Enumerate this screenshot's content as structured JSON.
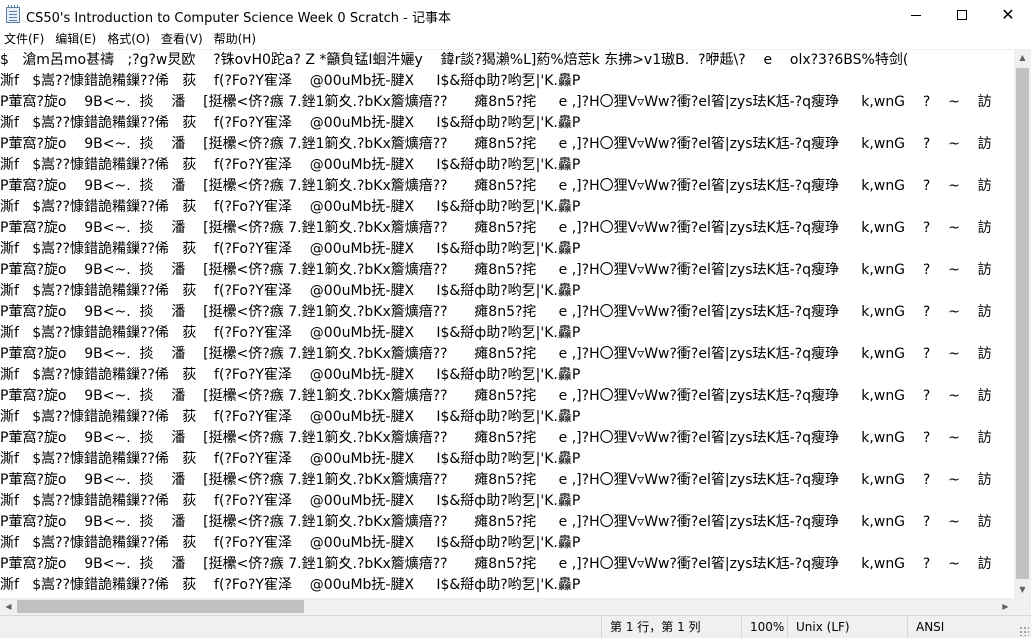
{
  "window": {
    "title": "CS50's Introduction to Computer Science Week 0 Scratch - 记事本",
    "app_icon": "notepad-icon",
    "controls": {
      "minimize": "minimize-icon",
      "maximize": "maximize-icon",
      "close": "✕"
    }
  },
  "menu": {
    "items": [
      "文件(F)",
      "编辑(E)",
      "格式(O)",
      "查看(V)",
      "帮助(H)"
    ]
  },
  "editor": {
    "lines": [
      "$   滄m呂mo甚禱   ;?g?w炅欧    ?铢ovH0跎a? Z *籲負锰Ⅰ蛔汼孋y    鍏r談?猲瀨%L]葯%焙莣k 东拂>v1璈B.  ?咿趆\\?    e    olx?3?6BS%特剑(",
      "澌f   $嵩??慷錯詭糒鏁??俙   荻    f(?Fo?Y寉泽    @00uMb抚-腱X     I$&搿ф助?哟乭|'K.灥P",
      "P葷窩?旋o    9B<~.  掞    潘    [挺欙<侪?瘯 7.銼1箣夊.?bKx簷爌瘖??      瘫8n5?挓     e ,]?H〇狸V▿Ww?衝?el箵|zys珐K尪-?q瘦琤     k,wnG    ?    ~    訪",
      "澌f   $嵩??慷錯詭糒鏁??俙   荻    f(?Fo?Y寉泽    @00uMb抚-腱X     I$&搿ф助?哟乭|'K.灥P",
      "P葷窩?旋o    9B<~.  掞    潘    [挺欙<侪?瘯 7.銼1箣夊.?bKx簷爌瘖??      瘫8n5?挓     e ,]?H〇狸V▿Ww?衝?el箵|zys珐K尪-?q瘦琤     k,wnG    ?    ~    訪",
      "澌f   $嵩??慷錯詭糒鏁??俙   荻    f(?Fo?Y寉泽    @00uMb抚-腱X     I$&搿ф助?哟乭|'K.灥P",
      "P葷窩?旋o    9B<~.  掞    潘    [挺欙<侪?瘯 7.銼1箣夊.?bKx簷爌瘖??      瘫8n5?挓     e ,]?H〇狸V▿Ww?衝?el箵|zys珐K尪-?q瘦琤     k,wnG    ?    ~    訪",
      "澌f   $嵩??慷錯詭糒鏁??俙   荻    f(?Fo?Y寉泽    @00uMb抚-腱X     I$&搿ф助?哟乭|'K.灥P",
      "P葷窩?旋o    9B<~.  掞    潘    [挺欙<侪?瘯 7.銼1箣夊.?bKx簷爌瘖??      瘫8n5?挓     e ,]?H〇狸V▿Ww?衝?el箵|zys珐K尪-?q瘦琤     k,wnG    ?    ~    訪",
      "澌f   $嵩??慷錯詭糒鏁??俙   荻    f(?Fo?Y寉泽    @00uMb抚-腱X     I$&搿ф助?哟乭|'K.灥P",
      "P葷窩?旋o    9B<~.  掞    潘    [挺欙<侪?瘯 7.銼1箣夊.?bKx簷爌瘖??      瘫8n5?挓     e ,]?H〇狸V▿Ww?衝?el箵|zys珐K尪-?q瘦琤     k,wnG    ?    ~    訪",
      "澌f   $嵩??慷錯詭糒鏁??俙   荻    f(?Fo?Y寉泽    @00uMb抚-腱X     I$&搿ф助?哟乭|'K.灥P",
      "P葷窩?旋o    9B<~.  掞    潘    [挺欙<侪?瘯 7.銼1箣夊.?bKx簷爌瘖??      瘫8n5?挓     e ,]?H〇狸V▿Ww?衝?el箵|zys珐K尪-?q瘦琤     k,wnG    ?    ~    訪",
      "澌f   $嵩??慷錯詭糒鏁??俙   荻    f(?Fo?Y寉泽    @00uMb抚-腱X     I$&搿ф助?哟乭|'K.灥P",
      "P葷窩?旋o    9B<~.  掞    潘    [挺欙<侪?瘯 7.銼1箣夊.?bKx簷爌瘖??      瘫8n5?挓     e ,]?H〇狸V▿Ww?衝?el箵|zys珐K尪-?q瘦琤     k,wnG    ?    ~    訪",
      "澌f   $嵩??慷錯詭糒鏁??俙   荻    f(?Fo?Y寉泽    @00uMb抚-腱X     I$&搿ф助?哟乭|'K.灥P",
      "P葷窩?旋o    9B<~.  掞    潘    [挺欙<侪?瘯 7.銼1箣夊.?bKx簷爌瘖??      瘫8n5?挓     e ,]?H〇狸V▿Ww?衝?el箵|zys珐K尪-?q瘦琤     k,wnG    ?    ~    訪",
      "澌f   $嵩??慷錯詭糒鏁??俙   荻    f(?Fo?Y寉泽    @00uMb抚-腱X     I$&搿ф助?哟乭|'K.灥P",
      "P葷窩?旋o    9B<~.  掞    潘    [挺欙<侪?瘯 7.銼1箣夊.?bKx簷爌瘖??      瘫8n5?挓     e ,]?H〇狸V▿Ww?衝?el箵|zys珐K尪-?q瘦琤     k,wnG    ?    ~    訪",
      "澌f   $嵩??慷錯詭糒鏁??俙   荻    f(?Fo?Y寉泽    @00uMb抚-腱X     I$&搿ф助?哟乭|'K.灥P",
      "P葷窩?旋o    9B<~.  掞    潘    [挺欙<侪?瘯 7.銼1箣夊.?bKx簷爌瘖??      瘫8n5?挓     e ,]?H〇狸V▿Ww?衝?el箵|zys珐K尪-?q瘦琤     k,wnG    ?    ~    訪",
      "澌f   $嵩??慷錯詭糒鏁??俙   荻    f(?Fo?Y寉泽    @00uMb抚-腱X     I$&搿ф助?哟乭|'K.灥P",
      "P葷窩?旋o    9B<~.  掞    潘    [挺欙<侪?瘯 7.銼1箣夊.?bKx簷爌瘖??      瘫8n5?挓     e ,]?H〇狸V▿Ww?衝?el箵|zys珐K尪-?q瘦琤     k,wnG    ?    ~    訪",
      "澌f   $嵩??慷錯詭糒鏁??俙   荻    f(?Fo?Y寉泽    @00uMb抚-腱X     I$&搿ф助?哟乭|'K.灥P",
      "P葷窩?旋o    9B<~.  掞    潘    [挺欙<侪?瘯 7.銼1箣夊.?bKx簷爌瘖??      瘫8n5?挓     e ,]?H〇狸V▿Ww?衝?el箵|zys珐K尪-?q瘦琤     k,wnG    ?    ~    訪",
      "澌f   $嵩??慷錯詭糒鏁??俙   荻    f(?Fo?Y寉泽    @00uMb抚-腱X     I$&搿ф助?哟乭|'K.灥P"
    ]
  },
  "status": {
    "position": "第 1 行，第 1 列",
    "zoom": "100%",
    "line_ending": "Unix (LF)",
    "encoding": "ANSI"
  },
  "colors": {
    "chrome": "#f0f0f0",
    "scroll_thumb": "#c1c1c1",
    "text": "#000000"
  }
}
